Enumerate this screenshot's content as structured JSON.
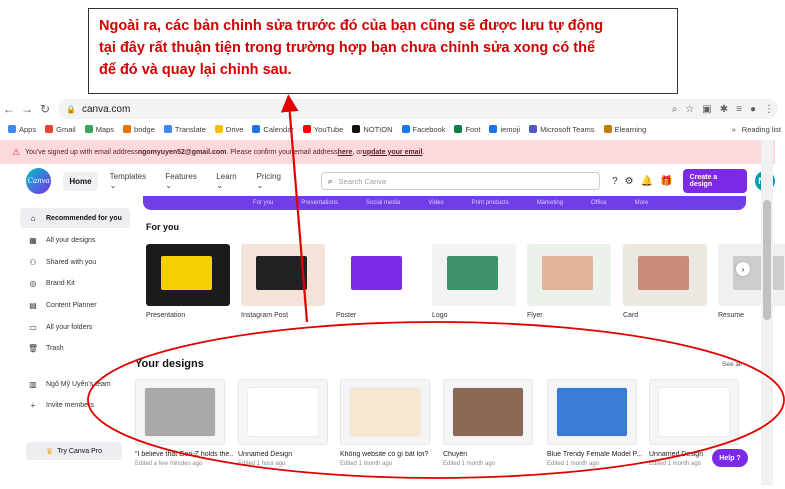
{
  "callout": {
    "text": "Ngoài ra, các bản chỉnh sửa trước đó của bạn cũng sẽ được lưu tự động\ntại đây rất thuận tiện trong trường hợp bạn chưa chỉnh sửa xong có thể\nđể đó và quay lại chỉnh sau."
  },
  "browser": {
    "url": "canva.com",
    "bookmarks": [
      "Apps",
      "Gmail",
      "Maps",
      "bridge",
      "Translate",
      "Drive",
      "Calendar",
      "YouTube",
      "NOTION",
      "Facebook",
      "Font",
      "iemoji",
      "Microsoft Teams",
      "Elearning"
    ],
    "reading_list": "Reading list"
  },
  "banner": {
    "prefix": "You've signed up with email address ",
    "email": "ngomyuyen52@gmail.com",
    "middle": ". Please confirm your email address ",
    "here": "here",
    "or": ", or ",
    "update": "update your email",
    "end": "."
  },
  "header": {
    "logo": "Canva",
    "home": "Home",
    "templates": "Templates ⌄",
    "features": "Features ⌄",
    "learn": "Learn ⌄",
    "pricing": "Pricing ⌄",
    "search_placeholder": "Search Canva",
    "create": "Create a design",
    "avatar": "NM"
  },
  "sidebar": {
    "items": [
      {
        "label": "Recommended for you",
        "icon": "⌂"
      },
      {
        "label": "All your designs",
        "icon": "▦"
      },
      {
        "label": "Shared with you",
        "icon": "⚇"
      },
      {
        "label": "Brand Kit",
        "icon": "◎"
      },
      {
        "label": "Content Planner",
        "icon": "▤"
      },
      {
        "label": "All your folders",
        "icon": "▭"
      },
      {
        "label": "Trash",
        "icon": "🗑"
      },
      {
        "label": "Ngô Mỹ Uyên's team",
        "icon": "▥"
      },
      {
        "label": "Invite members",
        "icon": "+"
      }
    ],
    "try_pro": "Try Canva Pro"
  },
  "for_you": {
    "title": "For you",
    "cards": [
      {
        "caption": "Presentation",
        "color": "#1b1b1b",
        "accent": "#f4d000"
      },
      {
        "caption": "Instagram Post",
        "color": "#f3e3d9",
        "accent": "#222222"
      },
      {
        "caption": "Poster",
        "color": "#ffffff",
        "accent": "#7d2ae8"
      },
      {
        "caption": "Logo",
        "color": "#f2f2f2",
        "accent": "#3f8f6a"
      },
      {
        "caption": "Flyer",
        "color": "#eaf2ea",
        "accent": "#e3b39a"
      },
      {
        "caption": "Card",
        "color": "#ece7e1",
        "accent": "#c98c7a"
      },
      {
        "caption": "Resume",
        "color": "#f0f0f0",
        "accent": "#cccccc"
      }
    ]
  },
  "your_designs": {
    "title": "Your designs",
    "see_all": "See all",
    "items": [
      {
        "name": "\"I believe that Gen-Z holds the...",
        "time": "Edited a few minutes ago",
        "color": "#a9a9a9"
      },
      {
        "name": "Unnamed Design",
        "time": "Edited 1 hour ago",
        "color": "#ffffff"
      },
      {
        "name": "Không website có gì bất lợi?",
        "time": "Edited 1 month ago",
        "color": "#f6e8cf"
      },
      {
        "name": "Chuyên",
        "time": "Edited 1 month ago",
        "color": "#8b6a55"
      },
      {
        "name": "Blue Trendy Female Model P...",
        "time": "Edited 1 month ago",
        "color": "#3a7bd5"
      },
      {
        "name": "Unnamed Design",
        "time": "Edited 1 month ago",
        "color": "#ffffff"
      }
    ]
  },
  "help": "Help ?",
  "annotation_color": "#e00000"
}
